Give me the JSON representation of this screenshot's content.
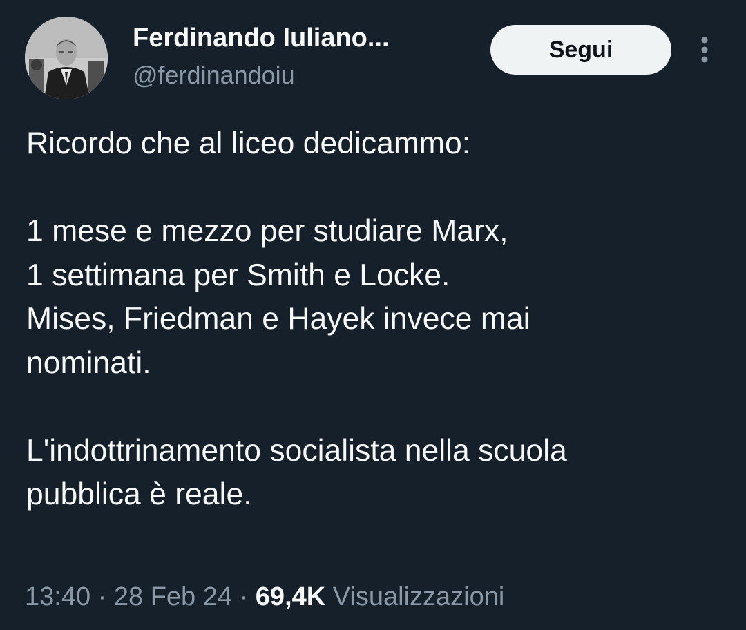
{
  "author": {
    "name": "Ferdinando Iuliano...",
    "handle": "@ferdinandoiu"
  },
  "follow_label": "Segui",
  "tweet": {
    "line1": "Ricordo che al liceo dedicammo:",
    "line2": "1 mese e mezzo per studiare Marx,",
    "line3": "1 settimana per Smith e Locke.",
    "line4": "Mises, Friedman e Hayek invece mai",
    "line5": "nominati.",
    "line6": "L'indottrinamento socialista nella scuola",
    "line7": "pubblica è reale."
  },
  "meta": {
    "time": "13:40",
    "separator1": " · ",
    "date": "28 Feb 24",
    "separator2": " · ",
    "views": "69,4K",
    "views_label": " Visualizzazioni"
  },
  "colors": {
    "background": "#15202b",
    "text": "#f7f9f9",
    "secondary": "#8b98a5",
    "button_bg": "#eff3f4"
  },
  "icons": {
    "more": "more-vertical-icon",
    "avatar": "avatar-photo"
  }
}
